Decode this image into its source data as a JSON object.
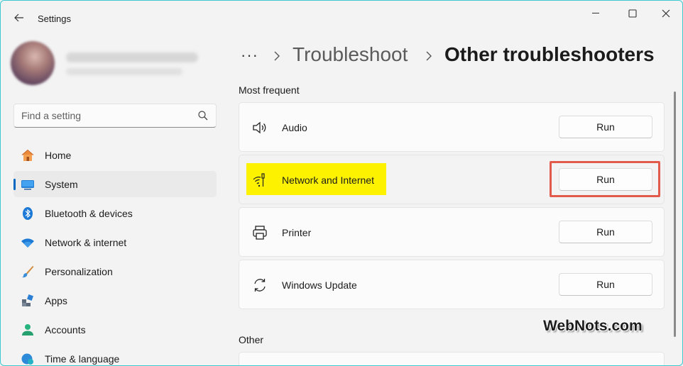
{
  "window": {
    "title": "Settings"
  },
  "sidebar": {
    "search_placeholder": "Find a setting",
    "items": [
      {
        "label": "Home"
      },
      {
        "label": "System"
      },
      {
        "label": "Bluetooth & devices"
      },
      {
        "label": "Network & internet"
      },
      {
        "label": "Personalization"
      },
      {
        "label": "Apps"
      },
      {
        "label": "Accounts"
      },
      {
        "label": "Time & language"
      }
    ]
  },
  "breadcrumb": {
    "more": "···",
    "parent": "Troubleshoot",
    "current": "Other troubleshooters"
  },
  "main": {
    "most_frequent_title": "Most frequent",
    "other_title": "Other",
    "troubleshooters": [
      {
        "label": "Audio",
        "button": "Run"
      },
      {
        "label": "Network and Internet",
        "button": "Run"
      },
      {
        "label": "Printer",
        "button": "Run"
      },
      {
        "label": "Windows Update",
        "button": "Run"
      }
    ]
  },
  "watermark": "WebNots.com",
  "colors": {
    "accent": "#0067c0",
    "highlight": "#fdf300",
    "callout_frame": "#e25a4b"
  }
}
